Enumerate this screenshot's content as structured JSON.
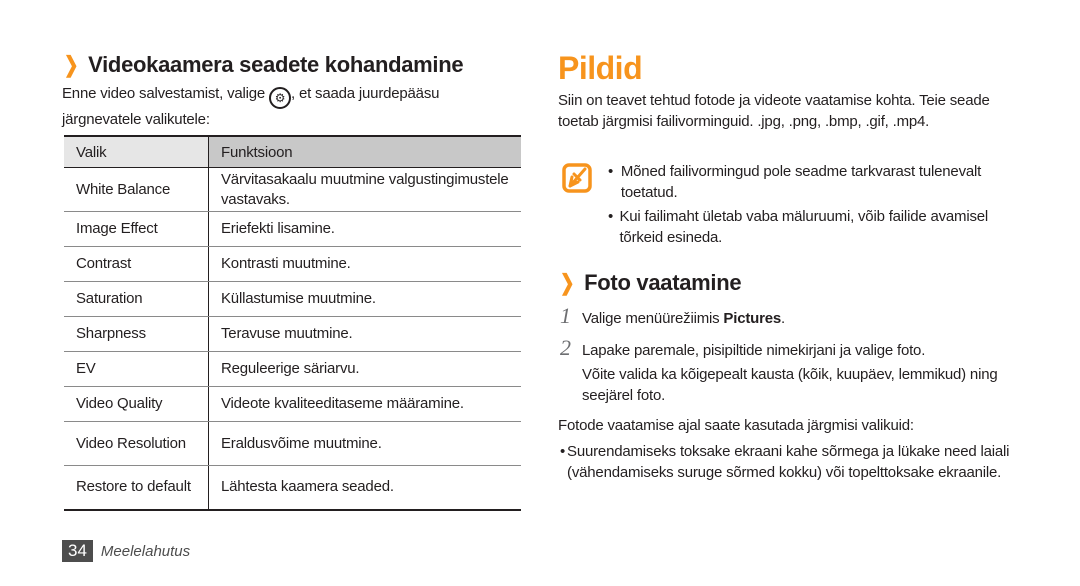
{
  "left": {
    "heading": "Videokaamera seadete kohandamine",
    "intro_before": "Enne video salvestamist, valige",
    "intro_icon": "settings-gear-icon",
    "intro_after": ", et saada juurdepääsu",
    "intro_line2": "järgnevatele valikutele:",
    "table": {
      "headers": [
        "Valik",
        "Funktsioon"
      ],
      "rows": [
        {
          "option": "White Balance",
          "function": "Värvitasakaalu muutmine valgustingimustele vastavaks."
        },
        {
          "option": "Image Effect",
          "function": "Eriefekti lisamine."
        },
        {
          "option": "Contrast",
          "function": "Kontrasti muutmine."
        },
        {
          "option": "Saturation",
          "function": "Küllastumise muutmine."
        },
        {
          "option": "Sharpness",
          "function": "Teravuse muutmine."
        },
        {
          "option": "EV",
          "function": "Reguleerige säriarvu."
        },
        {
          "option": "Video Quality",
          "function": "Videote kvaliteeditaseme määramine."
        },
        {
          "option": "Video Resolution",
          "function": "Eraldusvõime muutmine."
        },
        {
          "option": "Restore to default",
          "function": "Lähtesta kaamera seaded."
        }
      ]
    },
    "footer": {
      "page": "34",
      "section": "Meelelahutus"
    }
  },
  "right": {
    "title": "Pildid",
    "intro": "Siin on teavet tehtud fotode ja videote vaatamise kohta. Teie seade toetab järgmisi failivorminguid. .jpg, .png, .bmp, .gif, .mp4.",
    "note_icon": "note-pencil-icon",
    "notes": [
      "Mõned failivormingud pole seadme tarkvarast tulenevalt toetatud.",
      "Kui failimaht ületab vaba mäluruumi, võib failide avamisel tõrkeid esineda."
    ],
    "subheading": "Foto vaatamine",
    "steps": [
      {
        "n": "1",
        "before": "Valige menüürežiimis ",
        "bold": "Pictures",
        "after": "."
      },
      {
        "n": "2",
        "text": "Lapake paremale, pisipiltide nimekirjani ja valige foto.",
        "sub": "Võite valida ka kõigepealt kausta (kõik, kuupäev, lemmikud) ning seejärel foto."
      }
    ],
    "options_intro": "Fotode vaatamise ajal saate kasutada järgmisi valikuid:",
    "options": [
      "Suurendamiseks toksake ekraani kahe sõrmega ja lükake need laiali (vähendamiseks suruge sõrmed kokku) või topelttoksake ekraanile."
    ]
  },
  "colors": {
    "accent": "#f7941d",
    "text": "#231f20"
  }
}
